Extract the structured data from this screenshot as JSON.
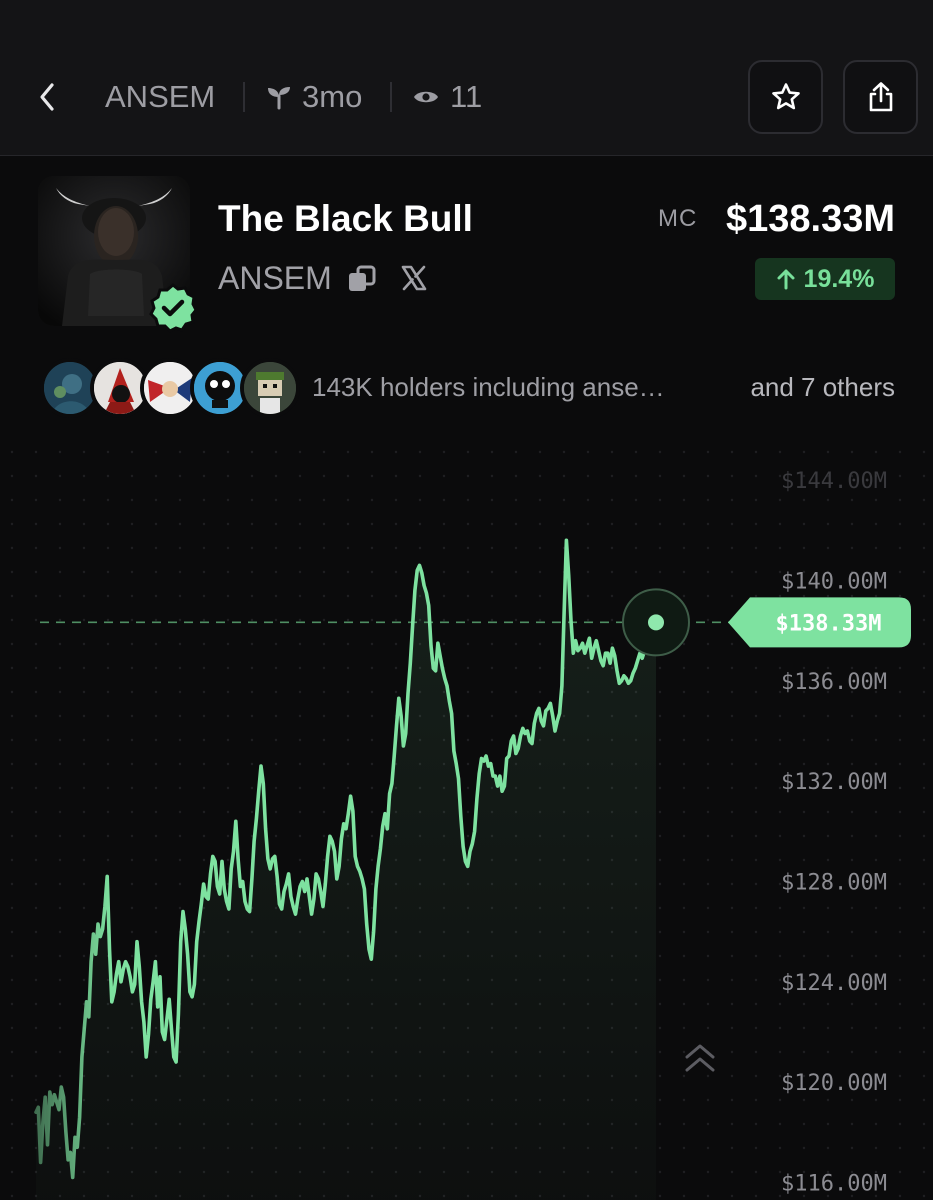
{
  "header": {
    "back_label": "back",
    "ticker": "ANSEM",
    "age": "3mo",
    "views": "11"
  },
  "token": {
    "name": "The Black Bull",
    "ticker": "ANSEM",
    "mc_label": "MC",
    "mc_value": "$138.33M",
    "change": "19.4%"
  },
  "holders": {
    "text": "143K holders including  anse…",
    "others": "and 7 others"
  },
  "colors": {
    "accent": "#7ee2a0",
    "background": "#0b0b0c",
    "change_bg": "#16351f"
  },
  "icons": [
    "chevron-left-icon",
    "sprout-icon",
    "eye-icon",
    "star-icon",
    "share-icon",
    "copy-icon",
    "x-logo-icon",
    "verified-check-icon"
  ],
  "chart_data": {
    "type": "line",
    "series": [
      {
        "values": [
          118.8,
          119.0,
          116.8,
          118.4,
          119.4,
          117.5,
          119.6,
          119.1,
          119.5,
          119.2,
          118.9,
          119.8,
          119.4,
          118.0,
          116.9,
          117.2,
          116.2,
          117.8,
          117.4,
          118.6,
          121.0,
          122.1,
          123.2,
          122.6,
          124.8,
          125.9,
          125.1,
          126.3,
          125.8,
          126.1,
          127.0,
          128.2,
          125.3,
          123.2,
          123.6,
          124.3,
          124.8,
          124.0,
          124.5,
          124.8,
          124.6,
          124.2,
          123.6,
          123.9,
          125.6,
          124.6,
          123.2,
          122.4,
          121.0,
          121.9,
          123.3,
          124.0,
          124.8,
          123.0,
          124.2,
          122.0,
          121.7,
          122.5,
          123.3,
          122.1,
          121.0,
          120.8,
          122.7,
          125.6,
          126.8,
          126.1,
          125.1,
          123.6,
          123.4,
          123.9,
          125.6,
          126.4,
          127.1,
          127.9,
          127.4,
          127.3,
          128.3,
          129.0,
          128.8,
          127.8,
          127.5,
          128.8,
          127.7,
          127.2,
          126.9,
          128.5,
          129.2,
          130.4,
          128.9,
          127.8,
          128.0,
          127.2,
          126.9,
          126.8,
          128.1,
          129.6,
          130.5,
          131.6,
          132.6,
          131.9,
          130.1,
          128.9,
          128.5,
          128.9,
          129.0,
          128.2,
          127.1,
          126.9,
          127.6,
          127.9,
          128.3,
          127.4,
          127.0,
          126.7,
          127.3,
          127.8,
          128.0,
          127.6,
          128.1,
          127.4,
          126.7,
          127.3,
          128.3,
          128.1,
          127.6,
          127.0,
          127.9,
          129.0,
          129.8,
          129.6,
          129.2,
          128.1,
          128.6,
          129.7,
          130.3,
          130.1,
          130.7,
          131.4,
          130.8,
          129.0,
          128.6,
          128.4,
          128.1,
          127.7,
          126.3,
          125.3,
          124.9,
          126.0,
          127.7,
          128.6,
          129.3,
          130.2,
          130.7,
          130.1,
          131.5,
          131.9,
          133.0,
          134.2,
          135.3,
          134.6,
          133.4,
          133.9,
          135.5,
          136.7,
          138.2,
          139.6,
          140.4,
          140.6,
          140.3,
          139.8,
          139.5,
          139.0,
          137.4,
          136.5,
          136.4,
          137.5,
          137.0,
          136.5,
          136.1,
          135.8,
          135.2,
          134.7,
          133.2,
          132.7,
          132.1,
          130.6,
          129.4,
          128.8,
          128.6,
          129.2,
          129.5,
          130.0,
          131.3,
          132.3,
          132.9,
          132.8,
          133.0,
          132.6,
          132.7,
          132.2,
          132.2,
          131.8,
          132.2,
          131.6,
          131.8,
          132.9,
          133.0,
          133.6,
          133.8,
          133.1,
          133.3,
          133.8,
          134.1,
          133.9,
          134.0,
          133.6,
          133.5,
          134.3,
          134.7,
          134.9,
          134.4,
          134.2,
          134.8,
          134.9,
          135.1,
          134.6,
          134.0,
          134.4,
          134.7,
          135.8,
          138.7,
          141.6,
          140.2,
          138.4,
          137.1,
          137.6,
          137.2,
          137.3,
          137.5,
          137.1,
          137.4,
          137.7,
          136.9,
          137.3,
          137.6,
          137.2,
          136.8,
          136.6,
          137.1,
          137.1,
          136.7,
          137.3,
          137.0,
          136.4,
          135.9,
          136.0,
          136.2,
          136.1,
          135.9,
          136.0,
          136.3,
          136.5,
          136.8,
          137.1,
          136.9,
          137.2,
          137.5,
          137.6,
          137.8,
          138.0,
          138.33
        ]
      }
    ],
    "current_value": 138.33,
    "current_label": "$138.33M",
    "y_ticks": [
      144,
      140,
      136,
      132,
      128,
      124,
      120,
      116
    ],
    "y_tick_labels": [
      "$144.00M",
      "$140.00M",
      "$136.00M",
      "$132.00M",
      "$128.00M",
      "$124.00M",
      "$120.00M",
      "$116.00M"
    ],
    "ylim": [
      115.3,
      145.6
    ],
    "grid": "dotted"
  }
}
